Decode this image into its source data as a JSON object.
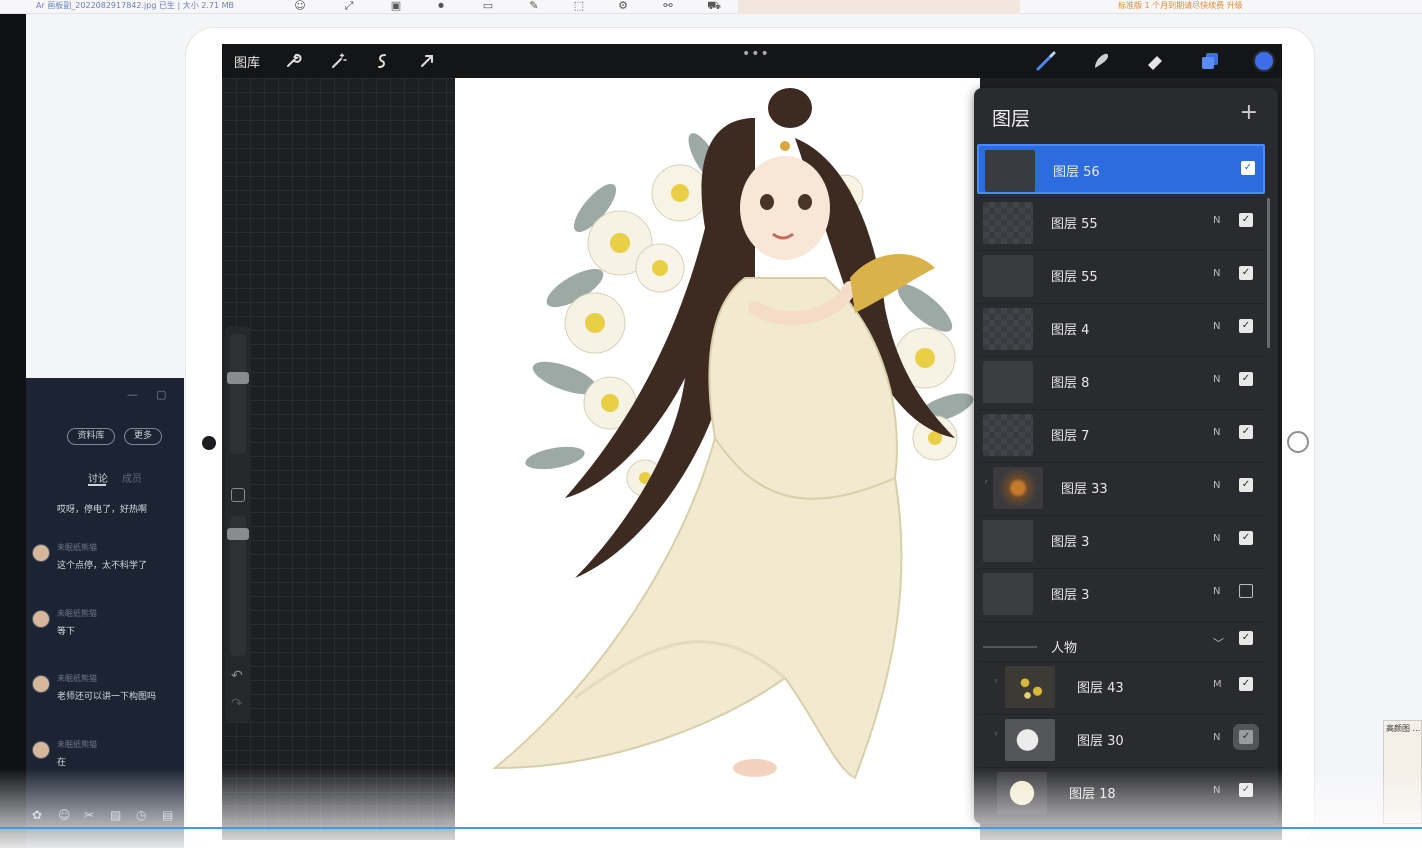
{
  "os_toolbar": {
    "doc_title": "Ar 画板副_2022082917842.jpg  已生 | 大小 2.71 MB",
    "right_link": "标准版 1 个月到期请尽快续费  升级"
  },
  "procreate": {
    "gallery_label": "图库",
    "more_dots": "•••",
    "accent_color": "#3b6ee8"
  },
  "layers_panel": {
    "title": "图层",
    "add_symbol": "+",
    "rows": [
      {
        "name": "图层 56",
        "blend": "",
        "visible": true,
        "active": true,
        "thumb": "dark-active"
      },
      {
        "name": "图层 55",
        "blend": "N",
        "visible": true,
        "thumb": "checker"
      },
      {
        "name": "图层 55",
        "blend": "N",
        "visible": true,
        "thumb": "curve"
      },
      {
        "name": "图层 4",
        "blend": "N",
        "visible": true,
        "thumb": "checker"
      },
      {
        "name": "图层 8",
        "blend": "N",
        "visible": true,
        "thumb": "solid"
      },
      {
        "name": "图层 7",
        "blend": "N",
        "visible": true,
        "thumb": "checker"
      },
      {
        "name": "图层 33",
        "blend": "N",
        "visible": true,
        "thumb": "orange",
        "clipped": true
      },
      {
        "name": "图层 3",
        "blend": "N",
        "visible": true,
        "thumb": "solid"
      },
      {
        "name": "图层 3",
        "blend": "N",
        "visible": false,
        "thumb": "solid"
      }
    ],
    "group": {
      "name": "人物",
      "chevron": "﹀",
      "visible": true
    },
    "group_rows": [
      {
        "name": "图层 43",
        "blend": "M",
        "visible": true,
        "thumb": "flowers"
      },
      {
        "name": "图层 30",
        "blend": "N",
        "visible": true,
        "thumb": "flower30"
      },
      {
        "name": "图层 18",
        "blend": "N",
        "visible": true,
        "thumb": "cream"
      }
    ]
  },
  "chat": {
    "minimize": "—",
    "maximize": "▢",
    "btn_library": "资料库",
    "btn_more": "更多",
    "tab_discussion": "讨论",
    "tab_members": "成员",
    "messages": [
      {
        "user": "",
        "text": "哎呀，停电了，好热啊"
      },
      {
        "user": "未眠纸熊猫",
        "text": "这个点停，太不科学了"
      },
      {
        "user": "未眠纸熊猫",
        "text": "等下"
      },
      {
        "user": "未眠纸熊猫",
        "text": "老师还可以讲一下构图吗"
      },
      {
        "user": "未眠纸熊猫",
        "text": "在"
      }
    ]
  },
  "pip": {
    "title": "高颜图 ..."
  }
}
